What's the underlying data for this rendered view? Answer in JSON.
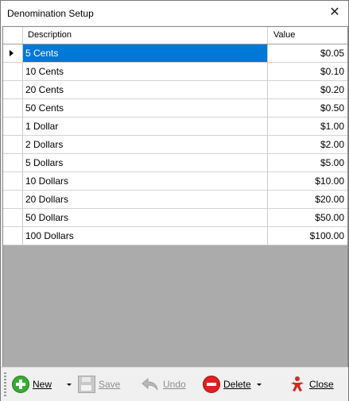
{
  "window": {
    "title": "Denomination Setup",
    "close_glyph": "✕"
  },
  "grid": {
    "columns": [
      "Description",
      "Value"
    ],
    "selected_index": 0,
    "rows": [
      {
        "description": "5 Cents",
        "value": "$0.05"
      },
      {
        "description": "10 Cents",
        "value": "$0.10"
      },
      {
        "description": "20 Cents",
        "value": "$0.20"
      },
      {
        "description": "50 Cents",
        "value": "$0.50"
      },
      {
        "description": "1 Dollar",
        "value": "$1.00"
      },
      {
        "description": "2 Dollars",
        "value": "$2.00"
      },
      {
        "description": "5 Dollars",
        "value": "$5.00"
      },
      {
        "description": "10 Dollars",
        "value": "$10.00"
      },
      {
        "description": "20 Dollars",
        "value": "$20.00"
      },
      {
        "description": "50 Dollars",
        "value": "$50.00"
      },
      {
        "description": "100 Dollars",
        "value": "$100.00"
      }
    ]
  },
  "toolbar": {
    "new_label": "New",
    "save_label": "Save",
    "undo_label": "Undo",
    "delete_label": "Delete",
    "close_label": "Close",
    "icons": {
      "new": "add-icon",
      "save": "floppy-disk-icon",
      "undo": "undo-arrow-icon",
      "delete": "remove-icon",
      "close": "exit-person-icon"
    },
    "colors": {
      "new": "#3aaa35",
      "delete": "#e02020",
      "close": "#d42a1e",
      "disabled_text": "#8d8d8d"
    }
  },
  "colors": {
    "selection": "#0078d7",
    "grid_background": "#ababab"
  }
}
